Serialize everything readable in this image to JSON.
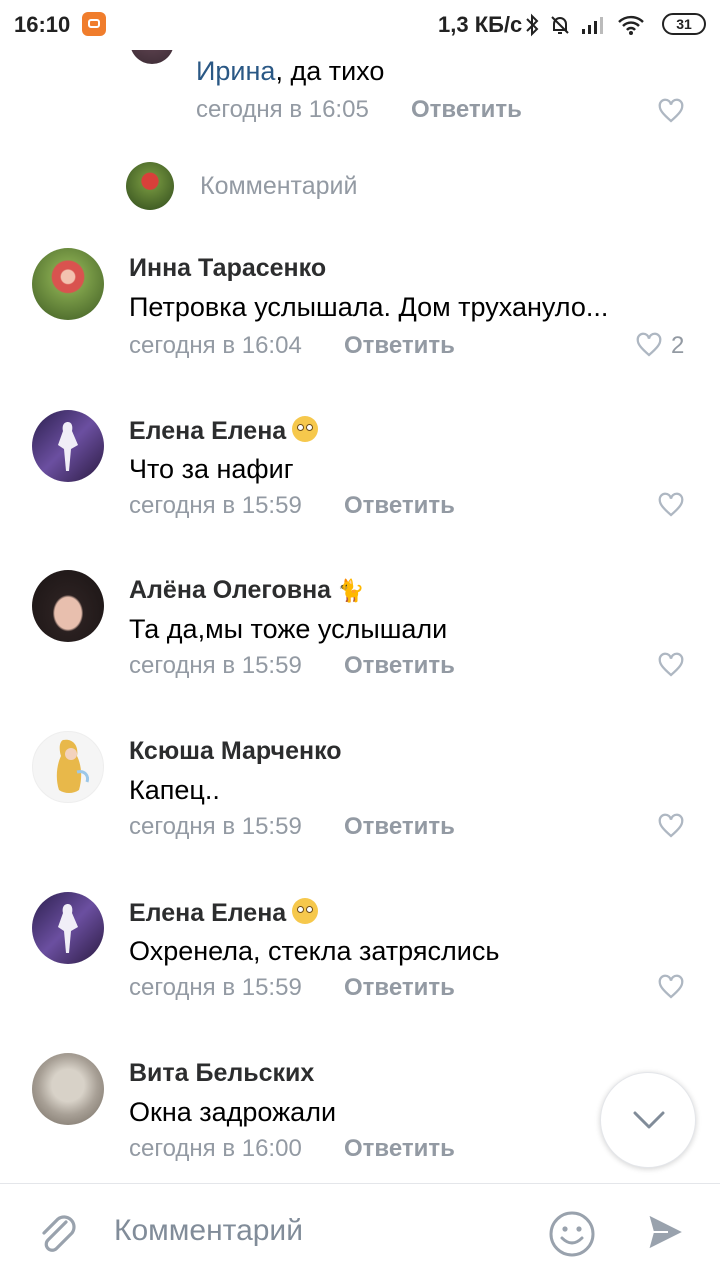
{
  "status_bar": {
    "time": "16:10",
    "speed": "1,3 КБ/с",
    "battery": "31",
    "icons": [
      "bluetooth-icon",
      "muted-bell-icon",
      "signal-icon",
      "wifi-icon"
    ]
  },
  "thread": {
    "top_reply": {
      "mention": "Ирина",
      "text": ", да тихо",
      "time": "сегодня в 16:05",
      "reply_label": "Ответить"
    },
    "reply_input_placeholder": "Комментарий",
    "comments": [
      {
        "author": "Инна Тарасенко",
        "text": "Петровка услышала. Дом трухануло...",
        "time": "сегодня в 16:04",
        "reply_label": "Ответить",
        "likes": "2"
      },
      {
        "author": "Елена Елена",
        "text": "Что за нафиг",
        "time": "сегодня в 15:59",
        "reply_label": "Ответить"
      },
      {
        "author": "Алёна Олеговна",
        "text": "Та да,мы тоже услышали",
        "time": "сегодня в 15:59",
        "reply_label": "Ответить"
      },
      {
        "author": "Ксюша Марченко",
        "text": "Капец..",
        "time": "сегодня в 15:59",
        "reply_label": "Ответить"
      },
      {
        "author": "Елена Елена",
        "text": "Охренела, стекла затряслись",
        "time": "сегодня в 15:59",
        "reply_label": "Ответить"
      },
      {
        "author": "Вита Бельских",
        "text": "Окна задрожали",
        "time": "сегодня в 16:00",
        "reply_label": "Ответить"
      }
    ]
  },
  "bottom_bar": {
    "placeholder": "Комментарий"
  },
  "colors": {
    "accent": "#2a5885",
    "secondary_text": "#939aa3",
    "icon": "#aeb7c2"
  }
}
